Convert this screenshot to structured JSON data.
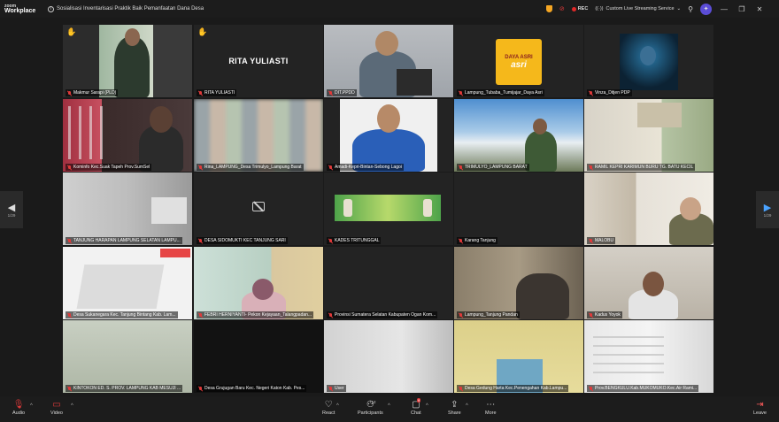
{
  "app": {
    "logo_line1": "zoom",
    "logo_line2": "Workplace"
  },
  "meeting": {
    "title": "Sosialisasi Inventarisasi Praktik Baik Pemanfaatan Dana Desa"
  },
  "titlebar": {
    "rec_label": "REC",
    "live_label": "Custom Live Streaming Service"
  },
  "pagination": {
    "left": "1/29",
    "right": "1/29"
  },
  "participants": [
    {
      "name": "Makmur Sarapi (PLD)"
    },
    {
      "name": "RITA YULIASTI",
      "big_label": "RITA YULIASTI"
    },
    {
      "name": "DIT.PPDD"
    },
    {
      "name": "Lampung_Tubaba_Tumijajar_Daya Asri",
      "logo_line1": "DAYA ASRI",
      "logo_line2": "asri"
    },
    {
      "name": "Vinza_Ditjen PDP"
    },
    {
      "name": "Kominfo Kec.Suak Tapeh Prov.SumSel"
    },
    {
      "name": "Rina_LAMPUNG_Desa Trimulyo_Lampung Barat"
    },
    {
      "name": "Amadi-Kepri-Bintan-Sebong Lagoi"
    },
    {
      "name": "TRIMULYO_LAMPUNG BARAT"
    },
    {
      "name": "RAMIL KEPRI KARIMUN BURU TG. BATU KECIL"
    },
    {
      "name": "TANJUNG HARAPAN LAMPUNG SELATAN LAMPU..."
    },
    {
      "name": "DESA SIDOMUKTI KEC TANJUNG SARI"
    },
    {
      "name": "KADES TRITUNGGAL"
    },
    {
      "name": "Karang Tanjung"
    },
    {
      "name": "MALOBU"
    },
    {
      "name": "Desa Sukanegara Kec. Tanjung Bintang Kab. Lam..."
    },
    {
      "name": "FEBRI HERNIYANTI- Pekon Kejayaan_Talangpadan..."
    },
    {
      "name": "Provinsi Sumatera Selatan Kabupaten Ogan Kom..."
    },
    {
      "name": "Lampung_Tanjung Pandan"
    },
    {
      "name": "Kadus Yoyok"
    },
    {
      "name": "KINTOKON ED. S. PROV. LAMPUNG KAB MESUJI ..."
    },
    {
      "name": "Desa Grujugan Baru Kec. Negeri Katon Kab. Pes..."
    },
    {
      "name": "User"
    },
    {
      "name": "Desa Gedung Harta Kec.Penengahan Kab.Lampu..."
    },
    {
      "name": "Prov.BENGKULU.Kab.MUKOMUKO.Kec.Air Rami..."
    }
  ],
  "toolbar": {
    "audio": "Audio",
    "video": "Video",
    "react": "React",
    "participants": "Participants",
    "participants_count": "712",
    "chat": "Chat",
    "chat_badge": "9",
    "share": "Share",
    "more": "More",
    "leave": "Leave"
  },
  "colors": {
    "active_speaker": "#3dd36b",
    "mic_muted": "#e03a3a",
    "rec": "#e02828",
    "leave": "#ff5c5c"
  }
}
